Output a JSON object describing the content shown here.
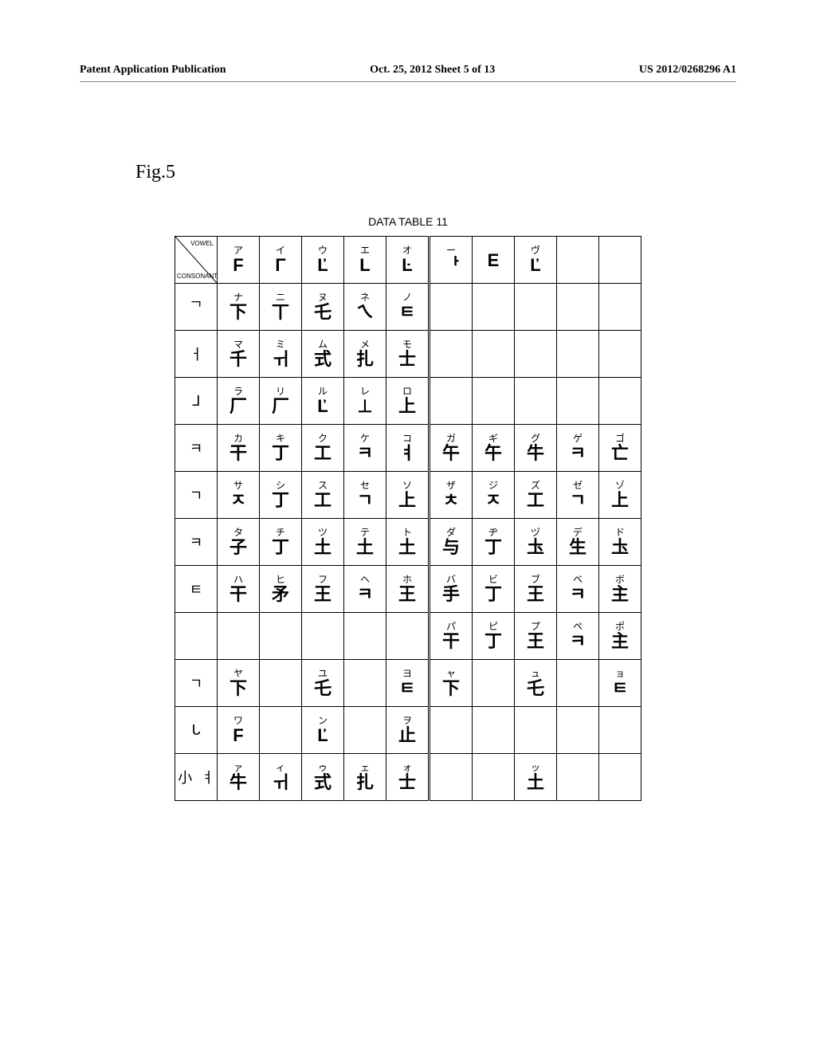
{
  "header": {
    "left": "Patent Application Publication",
    "center": "Oct. 25, 2012  Sheet 5 of 13",
    "right": "US 2012/0268296 A1"
  },
  "figure_label": "Fig.5",
  "table_title": "DATA TABLE  11",
  "corner": {
    "vowel": "VOWEL",
    "consonant": "CONSONANT"
  },
  "col_headers": [
    {
      "top": "ア",
      "bot": "F"
    },
    {
      "top": "イ",
      "bot": "Γ"
    },
    {
      "top": "ウ",
      "bot": "Ľ"
    },
    {
      "top": "エ",
      "bot": "L"
    },
    {
      "top": "オ",
      "bot": "Ŀ"
    },
    {
      "top": "ー",
      "bot": "ᅡ"
    },
    {
      "top": "",
      "bot": "E"
    },
    {
      "top": "ヴ",
      "bot": "Ľ"
    },
    {
      "top": "",
      "bot": ""
    },
    {
      "top": "",
      "bot": ""
    }
  ],
  "rows": [
    {
      "head": "ᄀ",
      "cells": [
        {
          "top": "ナ",
          "bot": "下"
        },
        {
          "top": "ニ",
          "bot": "丅"
        },
        {
          "top": "ヌ",
          "bot": "乇"
        },
        {
          "top": "ネ",
          "bot": "ㄟ"
        },
        {
          "top": "ノ",
          "bot": "ㅌ"
        },
        {
          "top": "",
          "bot": ""
        },
        {
          "top": "",
          "bot": ""
        },
        {
          "top": "",
          "bot": ""
        },
        {
          "top": "",
          "bot": ""
        },
        {
          "top": "",
          "bot": ""
        }
      ]
    },
    {
      "head": "ㅓ",
      "cells": [
        {
          "top": "マ",
          "bot": "千"
        },
        {
          "top": "ミ",
          "bot": "ㅟ"
        },
        {
          "top": "ム",
          "bot": "式"
        },
        {
          "top": "メ",
          "bot": "扎"
        },
        {
          "top": "モ",
          "bot": "士"
        },
        {
          "top": "",
          "bot": ""
        },
        {
          "top": "",
          "bot": ""
        },
        {
          "top": "",
          "bot": ""
        },
        {
          "top": "",
          "bot": ""
        },
        {
          "top": "",
          "bot": ""
        }
      ]
    },
    {
      "head": "ᒧ",
      "cells": [
        {
          "top": "ラ",
          "bot": "厂"
        },
        {
          "top": "リ",
          "bot": "厂"
        },
        {
          "top": "ル",
          "bot": "Ľ"
        },
        {
          "top": "レ",
          "bot": "⊥"
        },
        {
          "top": "ロ",
          "bot": "上"
        },
        {
          "top": "",
          "bot": ""
        },
        {
          "top": "",
          "bot": ""
        },
        {
          "top": "",
          "bot": ""
        },
        {
          "top": "",
          "bot": ""
        },
        {
          "top": "",
          "bot": ""
        }
      ]
    },
    {
      "head": "ㅋ",
      "cells": [
        {
          "top": "カ",
          "bot": "干"
        },
        {
          "top": "キ",
          "bot": "丁"
        },
        {
          "top": "ク",
          "bot": "工"
        },
        {
          "top": "ケ",
          "bot": "ㅋ"
        },
        {
          "top": "コ",
          "bot": "ㅕ"
        },
        {
          "top": "ガ",
          "bot": "午"
        },
        {
          "top": "ギ",
          "bot": "午"
        },
        {
          "top": "グ",
          "bot": "牛"
        },
        {
          "top": "ゲ",
          "bot": "ㅋ"
        },
        {
          "top": "ゴ",
          "bot": "亡"
        }
      ]
    },
    {
      "head": "ㄱ",
      "cells": [
        {
          "top": "サ",
          "bot": "ㅈ"
        },
        {
          "top": "シ",
          "bot": "丁"
        },
        {
          "top": "ス",
          "bot": "工"
        },
        {
          "top": "セ",
          "bot": "ㄱ"
        },
        {
          "top": "ソ",
          "bot": "上"
        },
        {
          "top": "ザ",
          "bot": "ㅊ"
        },
        {
          "top": "ジ",
          "bot": "ㅈ"
        },
        {
          "top": "ズ",
          "bot": "工"
        },
        {
          "top": "ゼ",
          "bot": "ㄱ"
        },
        {
          "top": "ゾ",
          "bot": "上"
        }
      ]
    },
    {
      "head": "ㅋ",
      "cells": [
        {
          "top": "タ",
          "bot": "子"
        },
        {
          "top": "チ",
          "bot": "丁"
        },
        {
          "top": "ツ",
          "bot": "土"
        },
        {
          "top": "テ",
          "bot": "土"
        },
        {
          "top": "ト",
          "bot": "土"
        },
        {
          "top": "ダ",
          "bot": "与"
        },
        {
          "top": "ヂ",
          "bot": "丁"
        },
        {
          "top": "ヅ",
          "bot": "圡"
        },
        {
          "top": "デ",
          "bot": "生"
        },
        {
          "top": "ド",
          "bot": "圡"
        }
      ]
    },
    {
      "head": "ㅌ",
      "cells": [
        {
          "top": "ハ",
          "bot": "干"
        },
        {
          "top": "ヒ",
          "bot": "矛"
        },
        {
          "top": "フ",
          "bot": "王"
        },
        {
          "top": "ヘ",
          "bot": "ㅋ"
        },
        {
          "top": "ホ",
          "bot": "王"
        },
        {
          "top": "バ",
          "bot": "手"
        },
        {
          "top": "ビ",
          "bot": "丁"
        },
        {
          "top": "ブ",
          "bot": "王"
        },
        {
          "top": "ベ",
          "bot": "ㅋ"
        },
        {
          "top": "ボ",
          "bot": "主"
        }
      ]
    },
    {
      "head": "",
      "cells": [
        {
          "top": "",
          "bot": ""
        },
        {
          "top": "",
          "bot": ""
        },
        {
          "top": "",
          "bot": ""
        },
        {
          "top": "",
          "bot": ""
        },
        {
          "top": "",
          "bot": ""
        },
        {
          "top": "パ",
          "bot": "干"
        },
        {
          "top": "ピ",
          "bot": "丁"
        },
        {
          "top": "プ",
          "bot": "王"
        },
        {
          "top": "ペ",
          "bot": "ㅋ"
        },
        {
          "top": "ポ",
          "bot": "主"
        }
      ]
    },
    {
      "head": "ㄱ",
      "cells": [
        {
          "top": "ヤ",
          "bot": "下"
        },
        {
          "top": "",
          "bot": ""
        },
        {
          "top": "ユ",
          "bot": "乇"
        },
        {
          "top": "",
          "bot": ""
        },
        {
          "top": "ヨ",
          "bot": "ㅌ"
        },
        {
          "top": "ャ",
          "bot": "下"
        },
        {
          "top": "",
          "bot": ""
        },
        {
          "top": "ュ",
          "bot": "乇"
        },
        {
          "top": "",
          "bot": ""
        },
        {
          "top": "ョ",
          "bot": "ㅌ"
        }
      ]
    },
    {
      "head": "ᒐ",
      "cells": [
        {
          "top": "ワ",
          "bot": "F"
        },
        {
          "top": "",
          "bot": ""
        },
        {
          "top": "ン",
          "bot": "Ľ"
        },
        {
          "top": "",
          "bot": ""
        },
        {
          "top": "ヲ",
          "bot": "止"
        },
        {
          "top": "",
          "bot": ""
        },
        {
          "top": "",
          "bot": ""
        },
        {
          "top": "",
          "bot": ""
        },
        {
          "top": "",
          "bot": ""
        },
        {
          "top": "",
          "bot": ""
        }
      ]
    },
    {
      "head": "小 ㅕ",
      "cells": [
        {
          "top": "ァ",
          "bot": "牛"
        },
        {
          "top": "ィ",
          "bot": "ㅟ"
        },
        {
          "top": "ゥ",
          "bot": "式"
        },
        {
          "top": "ェ",
          "bot": "扎"
        },
        {
          "top": "ォ",
          "bot": "士"
        },
        {
          "top": "",
          "bot": ""
        },
        {
          "top": "",
          "bot": ""
        },
        {
          "top": "ッ",
          "bot": "土"
        },
        {
          "top": "",
          "bot": ""
        },
        {
          "top": "",
          "bot": ""
        }
      ]
    }
  ]
}
